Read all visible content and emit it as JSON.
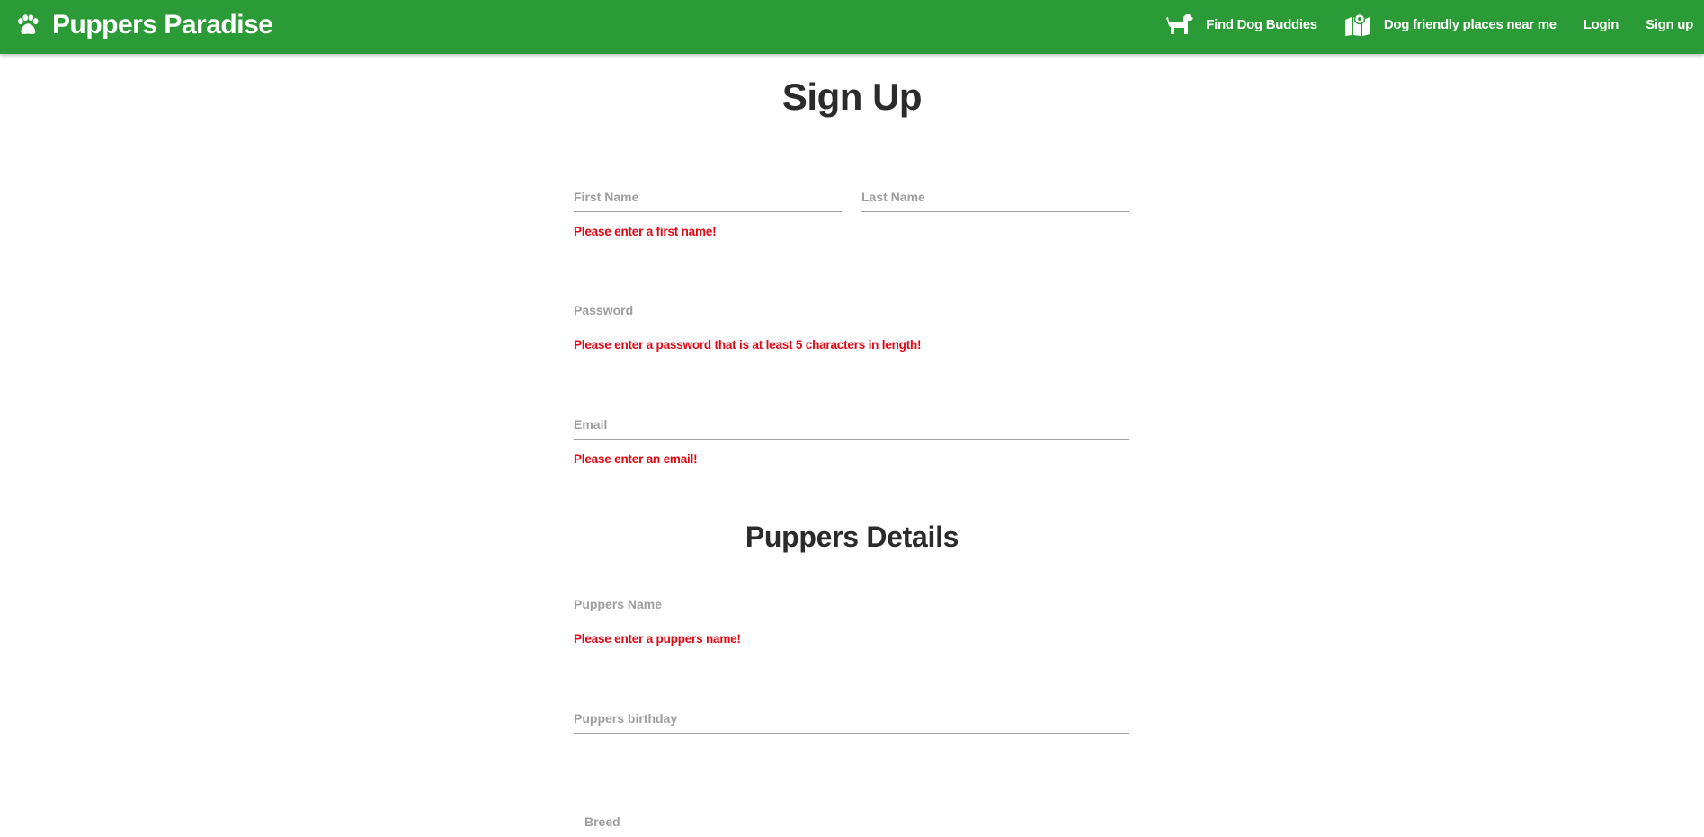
{
  "navbar": {
    "brand": "Puppers Paradise",
    "items": [
      {
        "label": "Find Dog Buddies",
        "icon": "dog-icon"
      },
      {
        "label": "Dog friendly places near me",
        "icon": "map-icon"
      },
      {
        "label": "Login"
      },
      {
        "label": "Sign up"
      }
    ]
  },
  "page": {
    "title": "Sign Up",
    "section_title": "Puppers Details"
  },
  "form": {
    "first_name": {
      "placeholder": "First Name",
      "error": "Please enter a first name!"
    },
    "last_name": {
      "placeholder": "Last Name"
    },
    "password": {
      "placeholder": "Password",
      "error": "Please enter a password that is at least 5 characters in length!"
    },
    "email": {
      "placeholder": "Email",
      "error": "Please enter an email!"
    },
    "puppers_name": {
      "placeholder": "Puppers Name",
      "error": "Please enter a puppers name!"
    },
    "puppers_birthday": {
      "placeholder": "Puppers birthday"
    },
    "breed": {
      "label": "Breed"
    }
  },
  "colors": {
    "navbar": "#2a9b36",
    "error": "#e30613",
    "underline": "#9e9e9e"
  }
}
